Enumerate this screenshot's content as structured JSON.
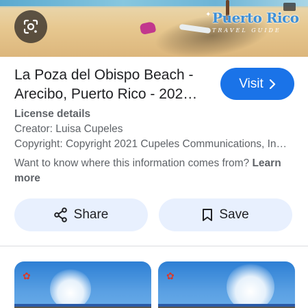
{
  "hero": {
    "logo_text": "Puerto Rico",
    "logo_subtext": "TRAVEL GUIDE",
    "lens_icon": "google-lens-icon"
  },
  "result": {
    "title": "La Poza del Obispo Beach - Arecibo, Puerto Rico - 202…",
    "visit_label": "Visit",
    "license_heading": "License details",
    "creator": "Creator: Luisa Cupeles",
    "copyright": "Copyright: Copyright 2021 Cupeles Communications, In…",
    "info_text": "Want to know where this information comes from?",
    "learn_more": "Learn more"
  },
  "actions": {
    "share_label": "Share",
    "save_label": "Save",
    "share_icon": "share-icon",
    "save_icon": "bookmark-icon"
  },
  "colors": {
    "accent": "#1a73e8",
    "button_bg": "#e8f0fe",
    "secondary_text": "#5f6368"
  }
}
